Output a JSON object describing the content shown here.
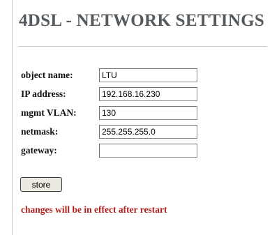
{
  "page": {
    "title": "4DSL - NETWORK SETTINGS"
  },
  "form": {
    "fields": [
      {
        "label": "object name:",
        "value": "LTU"
      },
      {
        "label": "IP address:",
        "value": "192.168.16.230"
      },
      {
        "label": "mgmt VLAN:",
        "value": "130"
      },
      {
        "label": "netmask:",
        "value": "255.255.255.0"
      },
      {
        "label": "gateway:",
        "value": ""
      }
    ],
    "store_label": "store"
  },
  "notice": {
    "text": "changes will be in effect after restart"
  },
  "colors": {
    "title": "#555a5f",
    "label": "#111111",
    "notice": "#b21e1e",
    "divider": "#c9c9c9",
    "button_bg": "#ece9e0"
  }
}
